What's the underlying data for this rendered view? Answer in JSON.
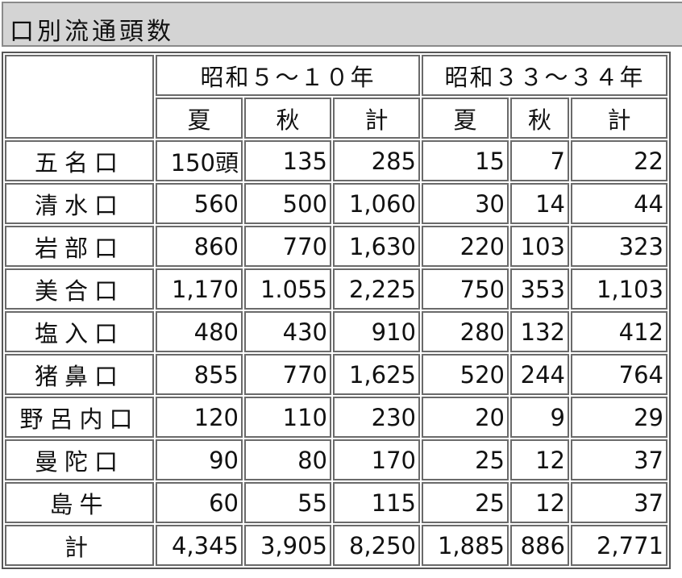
{
  "title": "口別流通頭数",
  "header": {
    "group_a": "昭和５～１０年",
    "group_b": "昭和３３～３４年",
    "summer": "夏",
    "autumn": "秋",
    "total": "計"
  },
  "rows": [
    {
      "name": "五名口",
      "a_summer": "150頭",
      "a_autumn": "135",
      "a_total": "285",
      "b_summer": "15",
      "b_autumn": "7",
      "b_total": "22"
    },
    {
      "name": "清水口",
      "a_summer": "560",
      "a_autumn": "500",
      "a_total": "1,060",
      "b_summer": "30",
      "b_autumn": "14",
      "b_total": "44"
    },
    {
      "name": "岩部口",
      "a_summer": "860",
      "a_autumn": "770",
      "a_total": "1,630",
      "b_summer": "220",
      "b_autumn": "103",
      "b_total": "323"
    },
    {
      "name": "美合口",
      "a_summer": "1,170",
      "a_autumn": "1.055",
      "a_total": "2,225",
      "b_summer": "750",
      "b_autumn": "353",
      "b_total": "1,103"
    },
    {
      "name": "塩入口",
      "a_summer": "480",
      "a_autumn": "430",
      "a_total": "910",
      "b_summer": "280",
      "b_autumn": "132",
      "b_total": "412"
    },
    {
      "name": "猪鼻口",
      "a_summer": "855",
      "a_autumn": "770",
      "a_total": "1,625",
      "b_summer": "520",
      "b_autumn": "244",
      "b_total": "764"
    },
    {
      "name": "野呂内口",
      "a_summer": "120",
      "a_autumn": "110",
      "a_total": "230",
      "b_summer": "20",
      "b_autumn": "9",
      "b_total": "29"
    },
    {
      "name": "曼陀口",
      "a_summer": "90",
      "a_autumn": "80",
      "a_total": "170",
      "b_summer": "25",
      "b_autumn": "12",
      "b_total": "37"
    },
    {
      "name": "島牛",
      "a_summer": "60",
      "a_autumn": "55",
      "a_total": "115",
      "b_summer": "25",
      "b_autumn": "12",
      "b_total": "37"
    },
    {
      "name": "計",
      "a_summer": "4,345",
      "a_autumn": "3,905",
      "a_total": "8,250",
      "b_summer": "1,885",
      "b_autumn": "886",
      "b_total": "2,771"
    }
  ]
}
